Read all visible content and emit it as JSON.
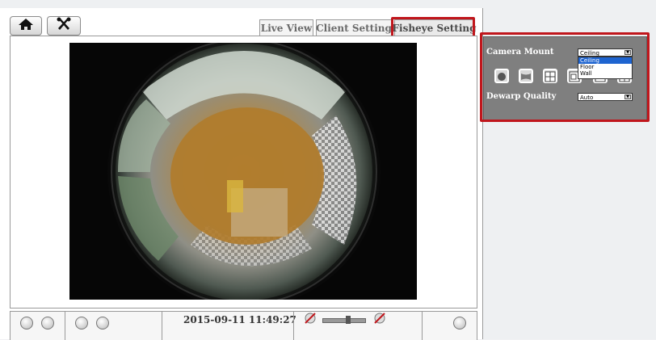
{
  "toolbar": {
    "home_icon": "home-icon",
    "settings_icon": "tools-icon"
  },
  "tabs": [
    {
      "label": "Live View"
    },
    {
      "label": "Client Setting"
    },
    {
      "label": "Fisheye Setting",
      "active": true
    }
  ],
  "status": {
    "timestamp": "2015-09-11 11:49:27"
  },
  "fisheye_panel": {
    "camera_mount_label": "Camera Mount",
    "camera_mount_value": "Ceiling",
    "camera_mount_options": [
      "Ceiling",
      "Floor",
      "Wall"
    ],
    "dewarp_quality_label": "Dewarp Quality",
    "dewarp_quality_value": "Auto",
    "display_modes": [
      "fisheye-original-icon",
      "panorama-icon",
      "quad-view-icon",
      "ptz-view-icon",
      "double-panorama-icon",
      "triple-view-icon"
    ]
  },
  "colors": {
    "highlight": "#c0161c",
    "panel_bg": "#7f7f7f",
    "selected_option": "#1e64d0"
  }
}
